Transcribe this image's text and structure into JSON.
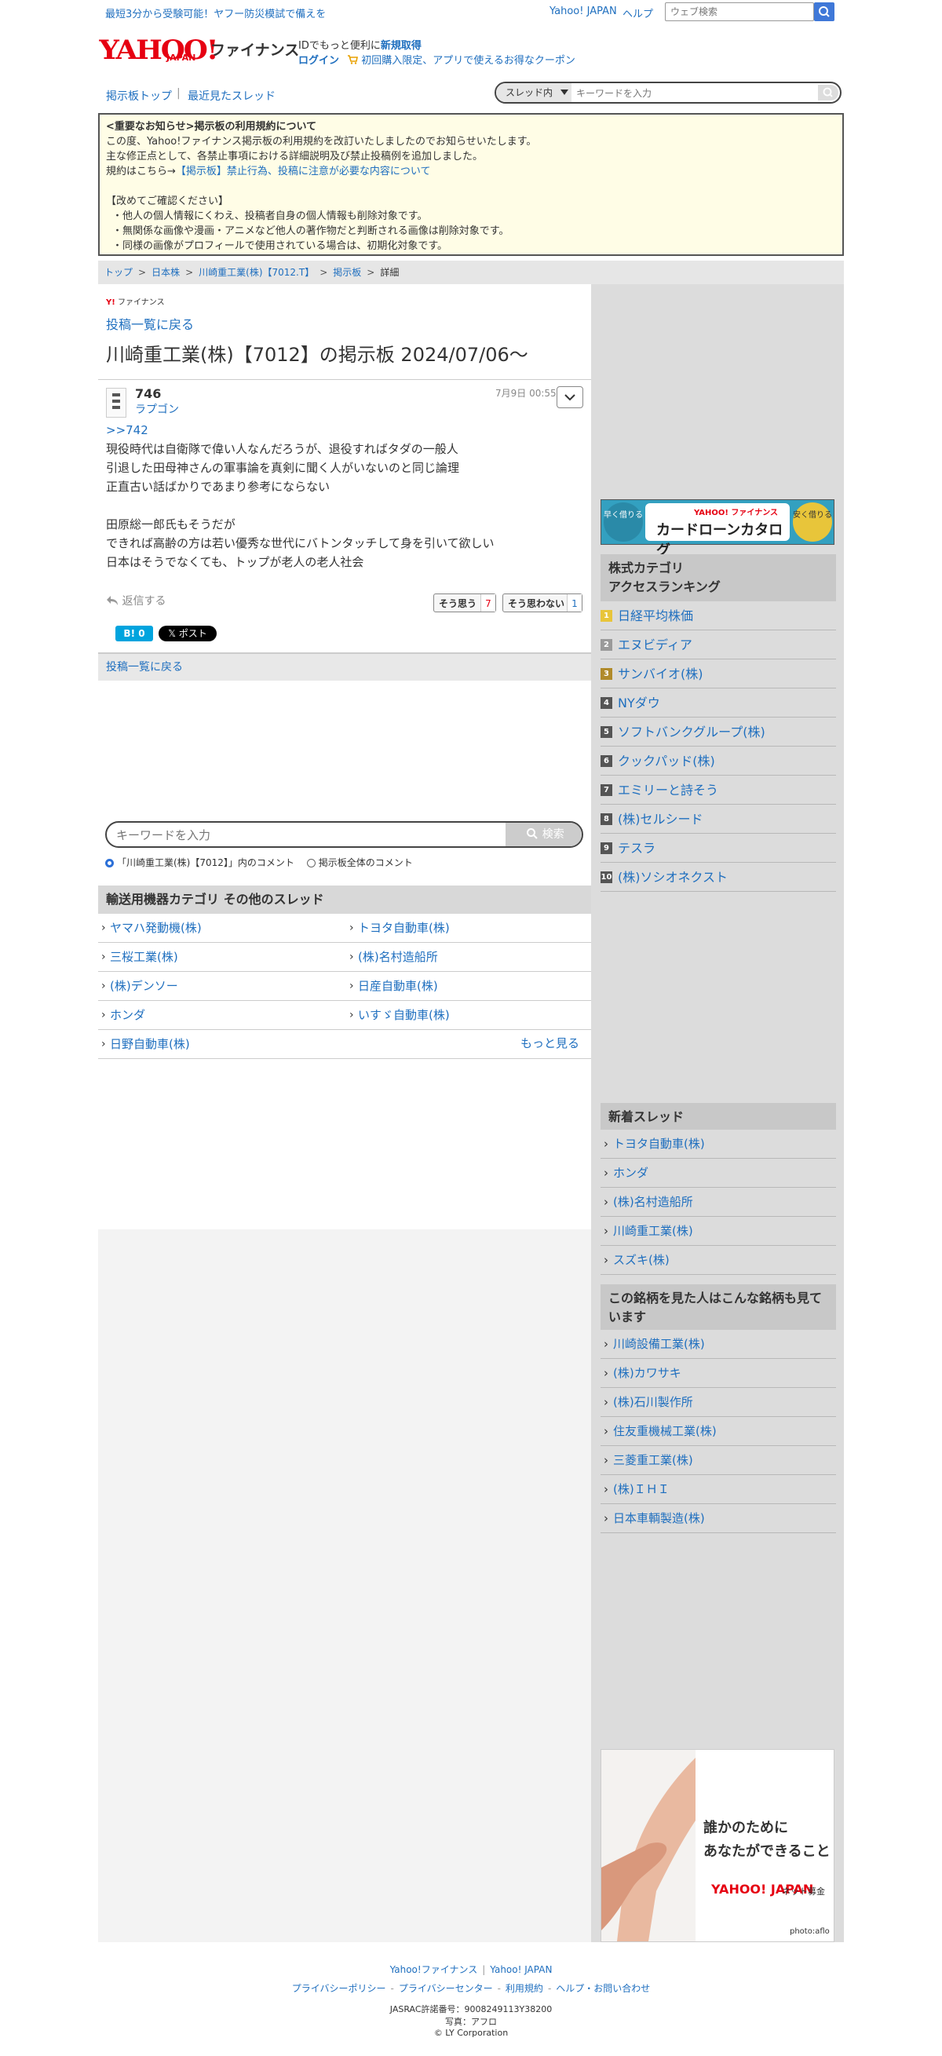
{
  "topbar": {
    "promo": "最短3分から受験可能！ヤフー防災模試で備えを",
    "yahoo_japan": "Yahoo! JAPAN",
    "help": "ヘルプ",
    "search_placeholder": "ウェブ検索"
  },
  "header": {
    "logo_yahoo": "YAHOO!",
    "logo_japan": "JAPAN",
    "logo_finance": "ファイナンス",
    "id_promo_text": "IDでもっと便利に",
    "signup": "新規取得",
    "login": "ログイン",
    "coupon": "初回購入限定、アプリで使えるお得なクーポン"
  },
  "nav": {
    "board_top": "掲示板トップ",
    "separator": "|",
    "recent": "最近見たスレッド",
    "scope": "スレッド内",
    "search_placeholder": "キーワードを入力"
  },
  "notice": {
    "title": "<重要なお知らせ>掲示板の利用規約について",
    "line1": "この度、Yahoo!ファイナンス掲示板の利用規約を改訂いたしましたのでお知らせいたします。",
    "line2": "主な修正点として、各禁止事項における詳細説明及び禁止投稿例を追加しました。",
    "line3_prefix": "規約はこちら→",
    "line3_link": "【掲示板】禁止行為、投稿に注意が必要な内容について",
    "confirm_head": "【改めてご確認ください】",
    "bullet1": "・他人の個人情報にくわえ、投稿者自身の個人情報も削除対象です。",
    "bullet2": "・無関係な画像や漫画・アニメなど他人の著作物だと判断される画像は削除対象です。",
    "bullet3": "・同様の画像がプロフィールで使用されている場合は、初期化対象です。"
  },
  "breadcrumb": {
    "items": [
      "トップ",
      "日本株",
      "川崎重工業(株)【7012.T】",
      "掲示板",
      "詳細"
    ],
    "sep": ">"
  },
  "main": {
    "small_logo_y": "Y!",
    "small_logo_text": "ファイナンス",
    "back_link": "投稿一覧に戻る",
    "title": "川崎重工業(株)【7012】の掲示板 2024/07/06〜"
  },
  "post": {
    "number": "746",
    "user": "ラプゴン",
    "date": "7月9日 00:55",
    "reply_to": ">>742",
    "lines": [
      "現役時代は自衛隊で偉い人なんだろうが、退役すればタダの一般人",
      "引退した田母神さんの軍事論を真剣に聞く人がいないのと同じ論理",
      "正直古い話ばかりであまり参考にならない",
      "",
      "田原総一郎氏もそうだが",
      "できれば高齢の方は若い優秀な世代にバトンタッチして身を引いて欲しい",
      "日本はそうでなくても、トップが老人の老人社会"
    ],
    "reply_label": "返信する",
    "agree_label": "そう思う",
    "agree_count": "7",
    "disagree_label": "そう思わない",
    "disagree_count": "1",
    "hatebu": "B! 0",
    "xpost": "𝕏 ポスト"
  },
  "back_bar": "投稿一覧に戻る",
  "bottom_search": {
    "placeholder": "キーワードを入力",
    "button": "検索",
    "radio_thread": "「川崎重工業(株)【7012】」内のコメント",
    "radio_all": "掲示板全体のコメント"
  },
  "category": {
    "title": "輸送用機器カテゴリ その他のスレッド",
    "items": [
      "ヤマハ発動機(株)",
      "トヨタ自動車(株)",
      "三桜工業(株)",
      "(株)名村造船所",
      "(株)デンソー",
      "日産自動車(株)",
      "ホンダ",
      "いすゞ自動車(株)",
      "日野自動車(株)"
    ],
    "more": "もっと見る"
  },
  "sidebar": {
    "cardloan_left": "早く借りる",
    "cardloan_brand": "YAHOO! ファイナンス",
    "cardloan_title": "カードローンカタログ",
    "cardloan_right": "安く借りる",
    "ranking_title_1": "株式カテゴリ",
    "ranking_title_2": "アクセスランキング",
    "ranking": [
      {
        "num": "1",
        "label": "日経平均株価",
        "color": "#e8c53a"
      },
      {
        "num": "2",
        "label": "エヌビディア",
        "color": "#9a9a9a"
      },
      {
        "num": "3",
        "label": "サンバイオ(株)",
        "color": "#b08a2a"
      },
      {
        "num": "4",
        "label": "NYダウ",
        "color": "#555555"
      },
      {
        "num": "5",
        "label": "ソフトバンクグループ(株)",
        "color": "#555555"
      },
      {
        "num": "6",
        "label": "クックパッド(株)",
        "color": "#555555"
      },
      {
        "num": "7",
        "label": "エミリーと詩そう",
        "color": "#555555"
      },
      {
        "num": "8",
        "label": "(株)セルシード",
        "color": "#555555"
      },
      {
        "num": "9",
        "label": "テスラ",
        "color": "#555555"
      },
      {
        "num": "10",
        "label": "(株)ソシオネクスト",
        "color": "#555555"
      }
    ],
    "new_threads_title": "新着スレッド",
    "new_threads": [
      "トヨタ自動車(株)",
      "ホンダ",
      "(株)名村造船所",
      "川崎重工業(株)",
      "スズキ(株)"
    ],
    "related_title": "この銘柄を見た人はこんな銘柄も見ています",
    "related": [
      "川崎設備工業(株)",
      "(株)カワサキ",
      "(株)石川製作所",
      "住友重機械工業(株)",
      "三菱重工業(株)",
      "(株)ＩＨＩ",
      "日本車輌製造(株)"
    ],
    "donate_line1": "誰かのために",
    "donate_line2": "あなたができること",
    "donate_brand": "YAHOO! JAPAN",
    "donate_brand2": "ネット募金",
    "donate_credit": "photo:aflo"
  },
  "footer": {
    "finance": "Yahoo!ファイナンス",
    "yj": "Yahoo! JAPAN",
    "privacy_policy": "プライバシーポリシー",
    "privacy_center": "プライバシーセンター",
    "terms": "利用規約",
    "help": "ヘルプ・お問い合わせ",
    "jasrac": "JASRAC許諾番号：9008249113Y38200",
    "photo": "写真：アフロ",
    "copyright": "© LY Corporation"
  }
}
